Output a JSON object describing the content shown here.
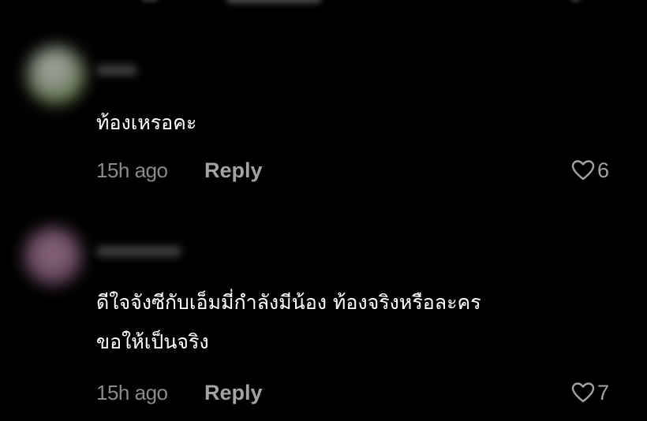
{
  "comments": [
    {
      "text_lines": [
        "ท้องเหรอคะ"
      ],
      "timestamp": "15h ago",
      "reply_label": "Reply",
      "likes": "6",
      "avatar_color": "#8f9a8a",
      "avatar_accent": "#6f8a3a"
    },
    {
      "text_lines": [
        "ดีใจจังซีกับเอ็มมี่กำลังมีน้อง ท้องจริงหรือละคร",
        "ขอให้เป็นจริง"
      ],
      "timestamp": "15h ago",
      "reply_label": "Reply",
      "likes": "7",
      "avatar_color": "#7a5a70",
      "avatar_accent": "#5a3a55"
    }
  ],
  "icons": {
    "like": "heart-outline-icon"
  },
  "colors": {
    "background": "#000000",
    "text": "#ffffff",
    "secondary": "#8a8a8a"
  }
}
